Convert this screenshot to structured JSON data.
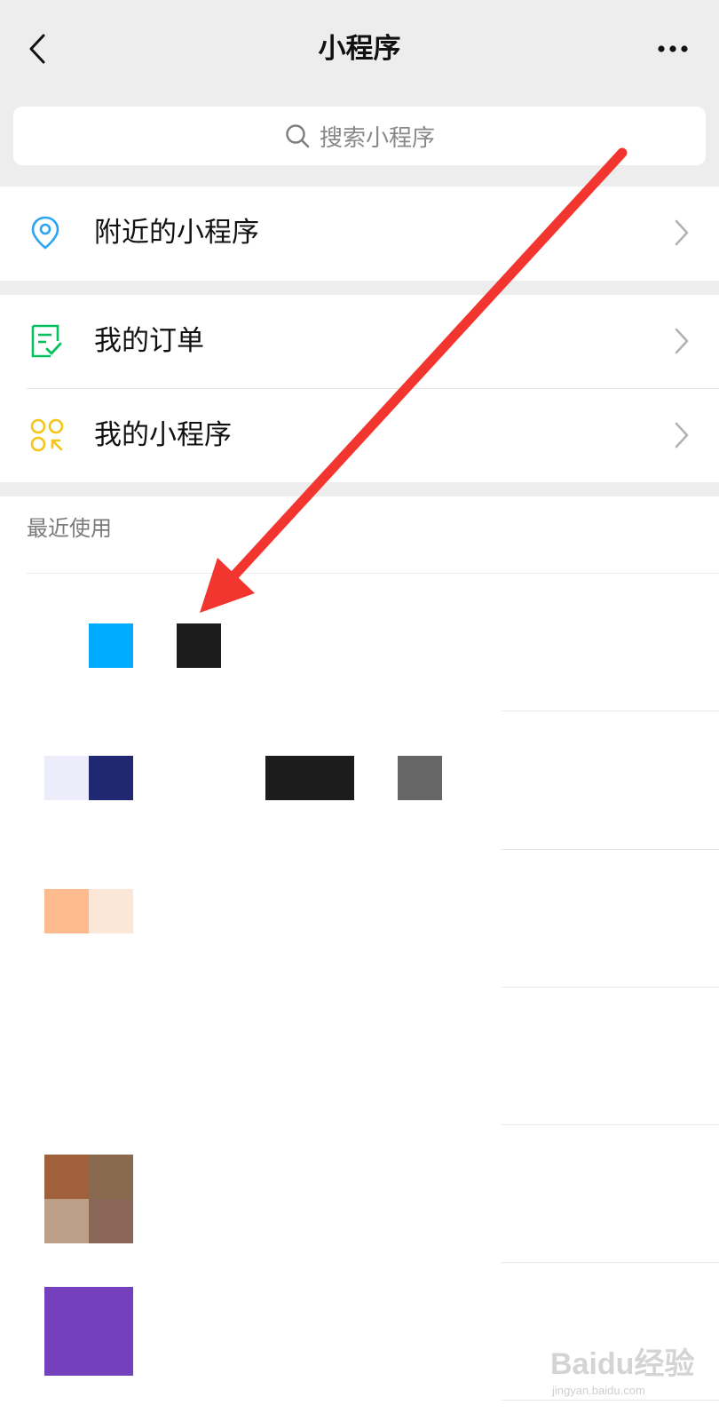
{
  "header": {
    "title": "小程序",
    "back_icon": "chevron-left-icon",
    "more_icon": "more-dots-icon"
  },
  "search": {
    "placeholder": "搜索小程序",
    "icon": "search-icon"
  },
  "menu": {
    "nearby": {
      "label": "附近的小程序",
      "icon": "location-pin-icon",
      "icon_color": "#2aa4f4"
    },
    "orders": {
      "label": "我的订单",
      "icon": "order-check-icon",
      "icon_color": "#07c160"
    },
    "mine": {
      "label": "我的小程序",
      "icon": "mini-program-icon",
      "icon_color": "#f5c518"
    }
  },
  "recent": {
    "label": "最近使用",
    "tiles": [
      {
        "name": "app-tile-1",
        "colors": [
          "#00aaff",
          "#1c1c1c"
        ]
      },
      {
        "name": "app-tile-2",
        "colors": [
          "#ececfa",
          "#1f2870",
          "#1c1c1c",
          "#666666"
        ]
      },
      {
        "name": "app-tile-3",
        "colors": [
          "#fdbb8e",
          "#fce6d7"
        ]
      },
      {
        "name": "app-tile-4",
        "colors": [
          "#a0603b",
          "#896a4e",
          "#bd9e87",
          "#8a6658"
        ]
      },
      {
        "name": "app-tile-5",
        "colors": [
          "#7440bc"
        ]
      }
    ]
  },
  "annotation": {
    "arrow_color": "#f2362f"
  },
  "watermark": {
    "main": "Baidu经验",
    "sub": "jingyan.baidu.com"
  }
}
